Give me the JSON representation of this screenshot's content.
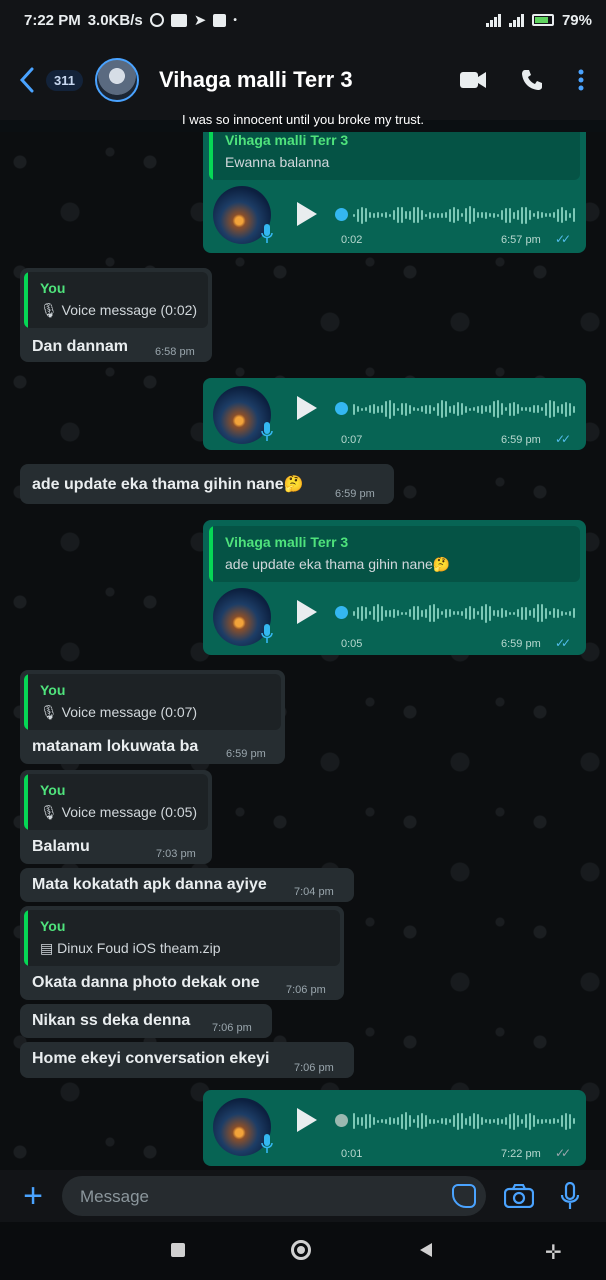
{
  "status_bar": {
    "time": "7:22 PM",
    "speed": "3.0KB/s",
    "battery": "79%"
  },
  "header": {
    "unread_count": "311",
    "contact_name": "Vihaga malli Terr 3",
    "status_text": "I was so innocent until you broke my trust."
  },
  "colors": {
    "accent": "#4aa3ff",
    "outgoing_bubble": "#076454",
    "incoming_bubble": "#262d31",
    "quote_name": "#4fe37c",
    "read_ticks": "#53bdeb"
  },
  "messages": [
    {
      "type": "voice",
      "direction": "out",
      "quote_name": "Vihaga malli Terr 3",
      "quote_text": "Ewanna balanna",
      "duration": "0:02",
      "time": "6:57 pm",
      "progress": 0.0
    },
    {
      "type": "text",
      "direction": "in",
      "quote_name": "You",
      "quote_text": "Voice message (0:02)",
      "text": "Dan dannam",
      "time": "6:58 pm"
    },
    {
      "type": "voice",
      "direction": "out",
      "duration": "0:07",
      "time": "6:59 pm",
      "progress": 0.0
    },
    {
      "type": "text",
      "direction": "in",
      "text": "ade update eka thama gihin nane🤔",
      "time": "6:59 pm"
    },
    {
      "type": "voice",
      "direction": "out",
      "quote_name": "Vihaga malli Terr 3",
      "quote_text": "ade update eka thama gihin nane🤔",
      "duration": "0:05",
      "time": "6:59 pm",
      "progress": 0.0
    },
    {
      "type": "text",
      "direction": "in",
      "quote_name": "You",
      "quote_text": "Voice message (0:07)",
      "text": "matanam lokuwata ba",
      "time": "6:59 pm"
    },
    {
      "type": "text",
      "direction": "in",
      "quote_name": "You",
      "quote_text": "Voice message (0:05)",
      "text": "Balamu",
      "time": "7:03 pm"
    },
    {
      "type": "text",
      "direction": "in",
      "text": "Mata kokatath apk danna ayiye",
      "time": "7:04 pm"
    },
    {
      "type": "text",
      "direction": "in",
      "quote_name": "You",
      "quote_text": "Dinux Foud iOS theam.zip",
      "text": "Okata danna photo dekak one",
      "time": "7:06 pm"
    },
    {
      "type": "text",
      "direction": "in",
      "text": "Nikan ss deka denna",
      "time": "7:06 pm"
    },
    {
      "type": "text",
      "direction": "in",
      "text": "Home ekeyi conversation ekeyi",
      "time": "7:06 pm"
    },
    {
      "type": "voice",
      "direction": "out",
      "duration": "0:01",
      "time": "7:22 pm",
      "progress": 0.0
    }
  ],
  "input": {
    "placeholder": "Message"
  },
  "icons": [
    "back-icon",
    "video-call-icon",
    "phone-icon",
    "more-icon",
    "plus-icon",
    "sticker-icon",
    "camera-icon",
    "mic-icon"
  ]
}
